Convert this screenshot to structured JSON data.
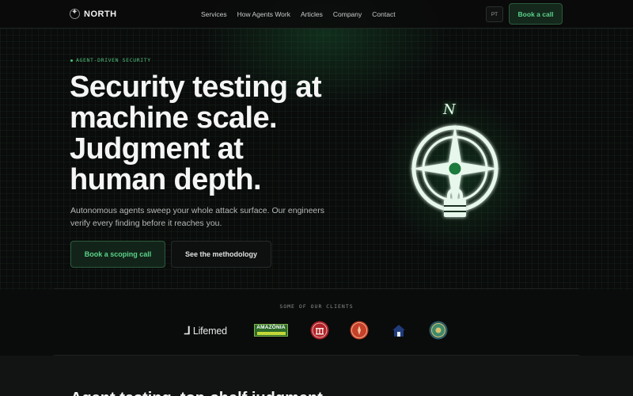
{
  "nav": {
    "brand": "NORTH",
    "links": [
      "Services",
      "How Agents Work",
      "Articles",
      "Company",
      "Contact"
    ],
    "lang": "PT",
    "cta": "Book a call"
  },
  "hero": {
    "eyebrow": "AGENT-DRIVEN SECURITY",
    "title_lines": [
      "Security testing at",
      "machine scale.",
      "Judgment at",
      "human depth."
    ],
    "subtitle": "Autonomous agents sweep your whole attack surface. Our engineers verify every finding before it reaches you.",
    "primary_cta": "Book a scoping call",
    "secondary_cta": "See the methodology",
    "compass_letter": "N"
  },
  "clients": {
    "label": "SOME OF OUR CLIENTS",
    "logos": [
      "lifemed-logo",
      "amazonia-logo",
      "institution-seal-logo",
      "red-seal-logo",
      "home-shield-logo",
      "emblem-logo"
    ],
    "lifemed_text": "Lifemed",
    "amazonia_text": "AMAZÔNIA"
  },
  "next_section": {
    "heading": "Agent testing, top-shelf judgment"
  },
  "colors": {
    "accent": "#5bd38a",
    "background": "#0a0b0b",
    "glow": "#3fd27a"
  }
}
